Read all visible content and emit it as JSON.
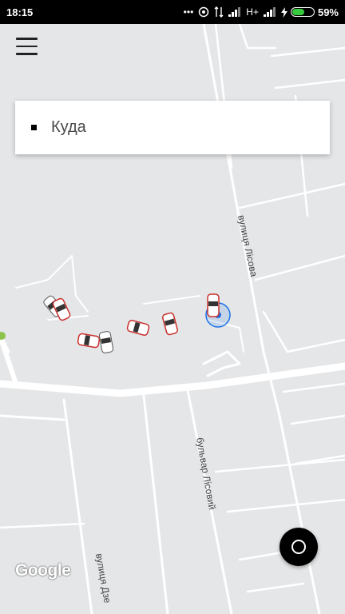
{
  "status_bar": {
    "time": "18:15",
    "more_icon": "•••",
    "network_type": "H+",
    "battery_percent": "59%",
    "battery_level": 0.59,
    "icons": [
      "more-dots-icon",
      "hotspot-icon",
      "data-transfer-icon",
      "signal-icon",
      "signal-icon",
      "charging-icon",
      "battery-icon"
    ]
  },
  "search": {
    "destination_label": "Куда"
  },
  "map": {
    "streets": [
      "вулиця Лісова",
      "бульвар Лісовий",
      "вулиця Дзе"
    ],
    "provider": "Google"
  },
  "colors": {
    "map_bg": "#e4e6e8",
    "road": "#ffffff",
    "accent": "#d9534f",
    "location": "#1a73e8"
  }
}
